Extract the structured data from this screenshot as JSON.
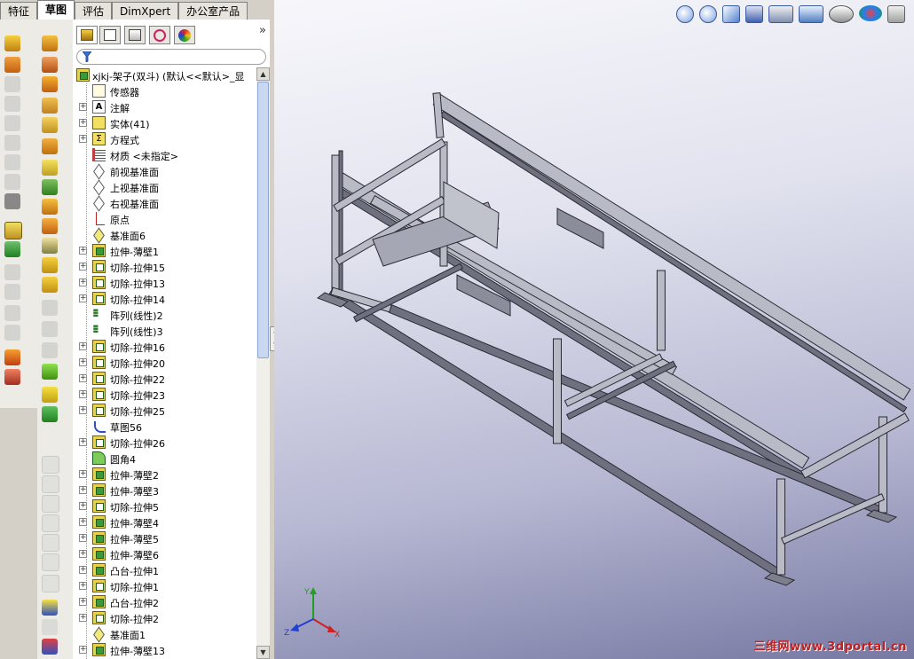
{
  "tabs": [
    {
      "label": "特征",
      "active": false
    },
    {
      "label": "草图",
      "active": true
    },
    {
      "label": "评估",
      "active": false
    },
    {
      "label": "DimXpert",
      "active": false
    },
    {
      "label": "办公室产品",
      "active": false
    }
  ],
  "feature_tree": {
    "root": "xjkj-架子(双斗)   (默认<<默认>_显",
    "items": [
      {
        "label": "传感器",
        "icon": "sensor-icon",
        "expand": false
      },
      {
        "label": "注解",
        "icon": "annotation-icon",
        "expand": true
      },
      {
        "label": "实体(41)",
        "icon": "solid-bodies-icon",
        "expand": true
      },
      {
        "label": "方程式",
        "icon": "equation-icon",
        "expand": true
      },
      {
        "label": "材质 <未指定>",
        "icon": "material-icon",
        "expand": false
      },
      {
        "label": "前视基准面",
        "icon": "plane-icon",
        "expand": false
      },
      {
        "label": "上视基准面",
        "icon": "plane-icon",
        "expand": false
      },
      {
        "label": "右视基准面",
        "icon": "plane-icon",
        "expand": false
      },
      {
        "label": "原点",
        "icon": "origin-icon",
        "expand": false
      },
      {
        "label": "基准面6",
        "icon": "plane-yellow-icon",
        "expand": false
      },
      {
        "label": "拉伸-薄壁1",
        "icon": "extrude-icon",
        "expand": true
      },
      {
        "label": "切除-拉伸15",
        "icon": "cut-icon",
        "expand": true
      },
      {
        "label": "切除-拉伸13",
        "icon": "cut-icon",
        "expand": true
      },
      {
        "label": "切除-拉伸14",
        "icon": "cut-icon",
        "expand": true
      },
      {
        "label": "阵列(线性)2",
        "icon": "pattern-icon",
        "expand": false
      },
      {
        "label": "阵列(线性)3",
        "icon": "pattern-icon",
        "expand": false
      },
      {
        "label": "切除-拉伸16",
        "icon": "cut-icon",
        "expand": true
      },
      {
        "label": "切除-拉伸20",
        "icon": "cut-icon",
        "expand": true
      },
      {
        "label": "切除-拉伸22",
        "icon": "cut-icon",
        "expand": true
      },
      {
        "label": "切除-拉伸23",
        "icon": "cut-icon",
        "expand": true
      },
      {
        "label": "切除-拉伸25",
        "icon": "cut-icon",
        "expand": true
      },
      {
        "label": "草图56",
        "icon": "sketch-icon",
        "expand": false
      },
      {
        "label": "切除-拉伸26",
        "icon": "cut-icon",
        "expand": true
      },
      {
        "label": "圆角4",
        "icon": "fillet-icon",
        "expand": false
      },
      {
        "label": "拉伸-薄壁2",
        "icon": "extrude-icon",
        "expand": true
      },
      {
        "label": "拉伸-薄壁3",
        "icon": "extrude-icon",
        "expand": true
      },
      {
        "label": "切除-拉伸5",
        "icon": "cut-icon",
        "expand": true
      },
      {
        "label": "拉伸-薄壁4",
        "icon": "extrude-icon",
        "expand": true
      },
      {
        "label": "拉伸-薄壁5",
        "icon": "extrude-icon",
        "expand": true
      },
      {
        "label": "拉伸-薄壁6",
        "icon": "extrude-icon",
        "expand": true
      },
      {
        "label": "凸台-拉伸1",
        "icon": "extrude-icon",
        "expand": true
      },
      {
        "label": "切除-拉伸1",
        "icon": "cut-icon",
        "expand": true
      },
      {
        "label": "凸台-拉伸2",
        "icon": "extrude-icon",
        "expand": true
      },
      {
        "label": "切除-拉伸2",
        "icon": "cut-icon",
        "expand": true
      },
      {
        "label": "基准面1",
        "icon": "plane-yellow-icon",
        "expand": false
      },
      {
        "label": "拉伸-薄壁13",
        "icon": "extrude-icon",
        "expand": true
      }
    ]
  },
  "triad": {
    "x": "X",
    "y": "Y",
    "z": "Z"
  },
  "watermark": "三维网www.3dportal.cn",
  "colors": {
    "frame_fill": "#9da0ad",
    "frame_stroke": "#2a2a32",
    "accent": "#f0c020"
  }
}
